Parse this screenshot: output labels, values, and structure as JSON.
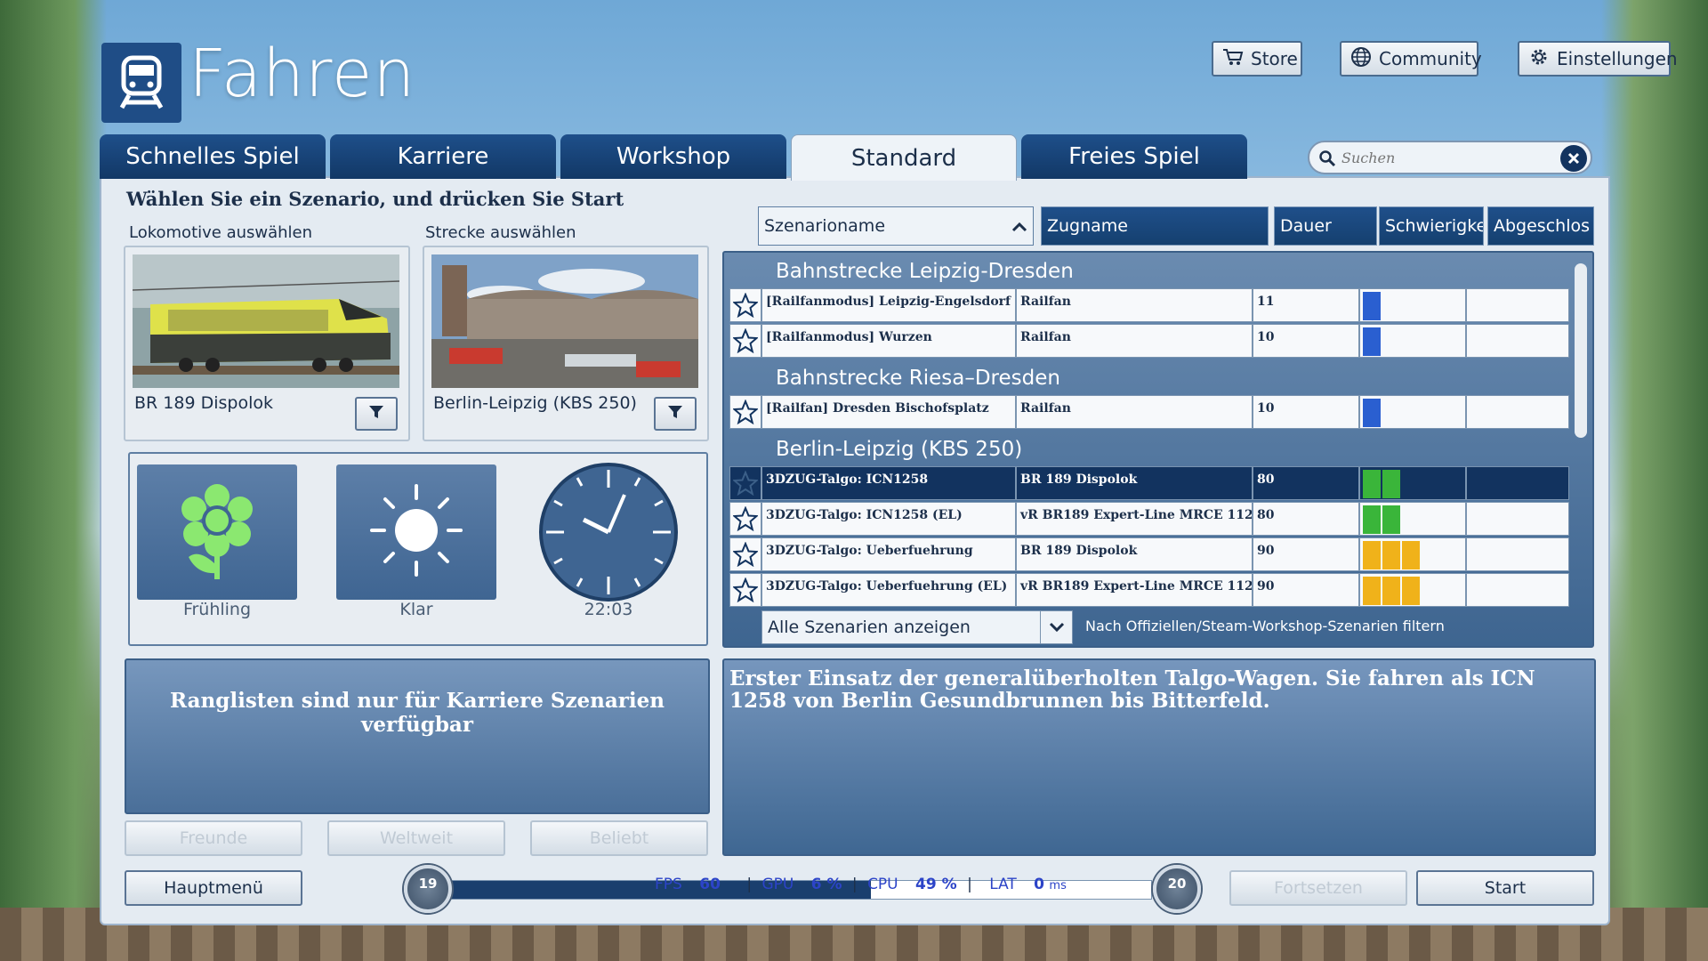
{
  "header": {
    "title": "Fahren"
  },
  "top_buttons": {
    "store": "Store",
    "community": "Community",
    "settings": "Einstellungen"
  },
  "tabs": [
    {
      "label": "Schnelles Spiel"
    },
    {
      "label": "Karriere"
    },
    {
      "label": "Workshop"
    },
    {
      "label": "Standard"
    },
    {
      "label": "Freies Spiel"
    }
  ],
  "active_tab": "Standard",
  "search": {
    "placeholder": "Suchen"
  },
  "instruction": "Wählen Sie ein Szenario, und drücken Sie Start",
  "loco": {
    "heading": "Lokomotive auswählen",
    "name": "BR 189 Dispolok"
  },
  "route": {
    "heading": "Strecke auswählen",
    "name": "Berlin-Leipzig (KBS 250)"
  },
  "conditions": {
    "season": "Frühling",
    "weather": "Klar",
    "time": "22:03"
  },
  "columns": {
    "scenario": "Szenarioname",
    "train": "Zugname",
    "duration": "Dauer",
    "difficulty": "Schwierigke",
    "completed": "Abgeschlos"
  },
  "groups": [
    {
      "name": "Bahnstrecke Leipzig-Dresden",
      "rows": [
        {
          "scenario": "[Railfanmodus] Leipzig-Engelsdorf",
          "train": "Railfan",
          "duration": "11",
          "difficulty": 1,
          "diff_color": "#2a5fd0"
        },
        {
          "scenario": "[Railfanmodus] Wurzen",
          "train": "Railfan",
          "duration": "10",
          "difficulty": 1,
          "diff_color": "#2a5fd0"
        }
      ]
    },
    {
      "name": "Bahnstrecke Riesa–Dresden",
      "rows": [
        {
          "scenario": "[Railfan] Dresden Bischofsplatz",
          "train": "Railfan",
          "duration": "10",
          "difficulty": 1,
          "diff_color": "#2a5fd0"
        }
      ]
    },
    {
      "name": "Berlin-Leipzig (KBS 250)",
      "rows": [
        {
          "scenario": "3DZUG-Talgo: ICN1258",
          "train": "BR 189 Dispolok",
          "duration": "80",
          "difficulty": 2,
          "diff_color": "#3ab53a",
          "selected": true
        },
        {
          "scenario": "3DZUG-Talgo: ICN1258 (EL)",
          "train": "vR BR189 Expert-Line MRCE 112",
          "duration": "80",
          "difficulty": 2,
          "diff_color": "#3ab53a"
        },
        {
          "scenario": "3DZUG-Talgo: Ueberfuehrung",
          "train": "BR 189 Dispolok",
          "duration": "90",
          "difficulty": 3,
          "diff_color": "#f0b21a"
        },
        {
          "scenario": "3DZUG-Talgo: Ueberfuehrung (EL)",
          "train": "vR BR189 Expert-Line MRCE 112",
          "duration": "90",
          "difficulty": 3,
          "diff_color": "#f0b21a"
        }
      ]
    }
  ],
  "filter": {
    "selected": "Alle Szenarien anzeigen",
    "hint": "Nach Offiziellen/Steam-Workshop-Szenarien filtern"
  },
  "description": "Erster Einsatz der generalüberholten Talgo-Wagen. Sie fahren als ICN 1258 von Berlin Gesundbrunnen bis Bitterfeld.",
  "leaderboard": {
    "message": "Ranglisten sind nur für Karriere Szenarien verfügbar",
    "buttons": {
      "friends": "Freunde",
      "world": "Weltweit",
      "popular": "Beliebt"
    }
  },
  "footer": {
    "main_menu": "Hauptmenü",
    "continue": "Fortsetzen",
    "start": "Start",
    "level_current": "19",
    "level_next": "20",
    "xp_progress": 0.6
  },
  "perf": {
    "fps_label": "FPS",
    "fps": "60",
    "gpu_label": "GPU",
    "gpu": "6 %",
    "cpu_label": "CPU",
    "cpu": "49 %",
    "lat_label": "LAT",
    "lat": "0",
    "lat_unit": "ms"
  },
  "colors": {
    "accent": "#1f4d86",
    "selected_row": "#12335f"
  }
}
